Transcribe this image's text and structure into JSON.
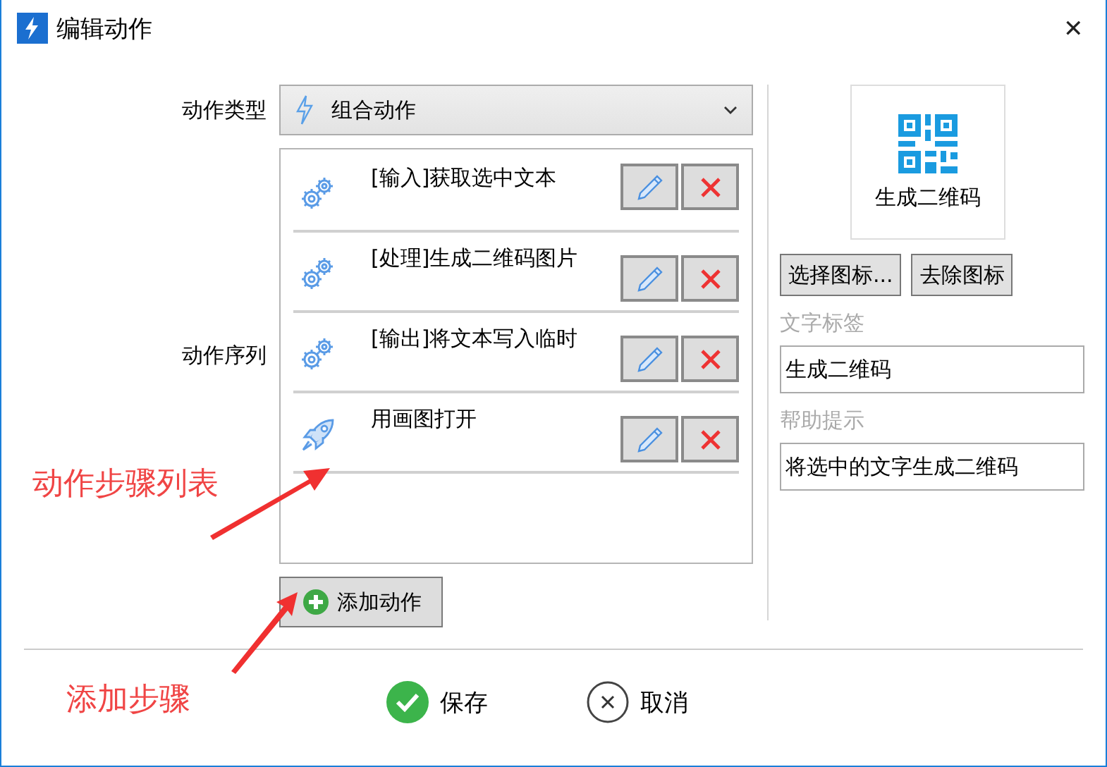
{
  "window": {
    "title": "编辑动作",
    "close": "✕"
  },
  "action_type": {
    "label": "动作类型",
    "value": "组合动作"
  },
  "sequence": {
    "label": "动作序列",
    "steps": [
      {
        "text": "[输入]获取选中文本",
        "kind": "gears"
      },
      {
        "text": "[处理]生成二维码图片",
        "kind": "gears"
      },
      {
        "text": "[输出]将文本写入临时",
        "kind": "gears"
      },
      {
        "text": "用画图打开",
        "kind": "rocket"
      }
    ],
    "add_button": "添加动作"
  },
  "icon_preview": {
    "caption": "生成二维码"
  },
  "icon_buttons": [
    "选择图标...",
    "去除图标"
  ],
  "fields": [
    {
      "label": "文字标签",
      "value": "生成二维码"
    },
    {
      "label": "帮助提示",
      "value": "将选中的文字生成二维码"
    }
  ],
  "footer": {
    "save": "保存",
    "cancel": "取消"
  },
  "annotations": [
    {
      "text": "动作步骤列表"
    },
    {
      "text": "添加步骤"
    }
  ]
}
